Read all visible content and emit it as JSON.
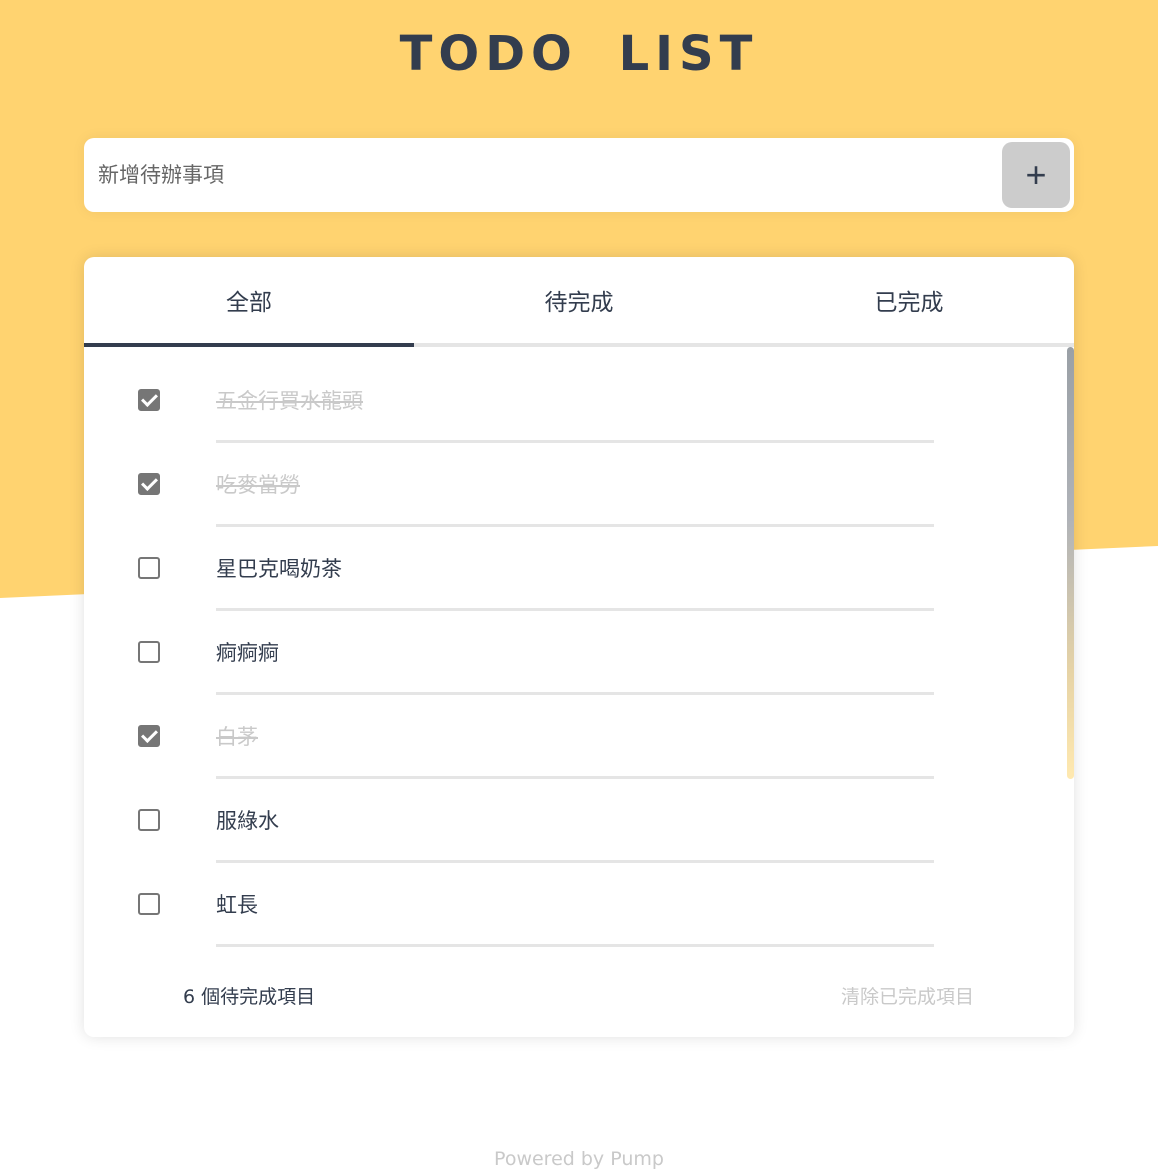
{
  "colors": {
    "accent": "#FFD370",
    "primary_text": "#333D4E",
    "muted_text": "#9F9A91",
    "divider": "#E5E5E5"
  },
  "header": {
    "title": "TODO  LIST"
  },
  "add": {
    "placeholder": "新增待辦事項",
    "button_icon": "plus-icon",
    "button_label": "+"
  },
  "tabs": [
    {
      "label": "全部",
      "active": true
    },
    {
      "label": "待完成",
      "active": false
    },
    {
      "label": "已完成",
      "active": false
    }
  ],
  "todos": [
    {
      "text": "五金行買水龍頭",
      "done": true
    },
    {
      "text": "吃麥當勞",
      "done": true
    },
    {
      "text": "星巴克喝奶茶",
      "done": false
    },
    {
      "text": "痾痾痾",
      "done": false
    },
    {
      "text": "白茅",
      "done": true
    },
    {
      "text": "服綠水",
      "done": false
    },
    {
      "text": "虹長",
      "done": false
    }
  ],
  "footer": {
    "count": "6 個待完成項目",
    "clear": "清除已完成項目"
  },
  "powered": "Powered by Pump"
}
